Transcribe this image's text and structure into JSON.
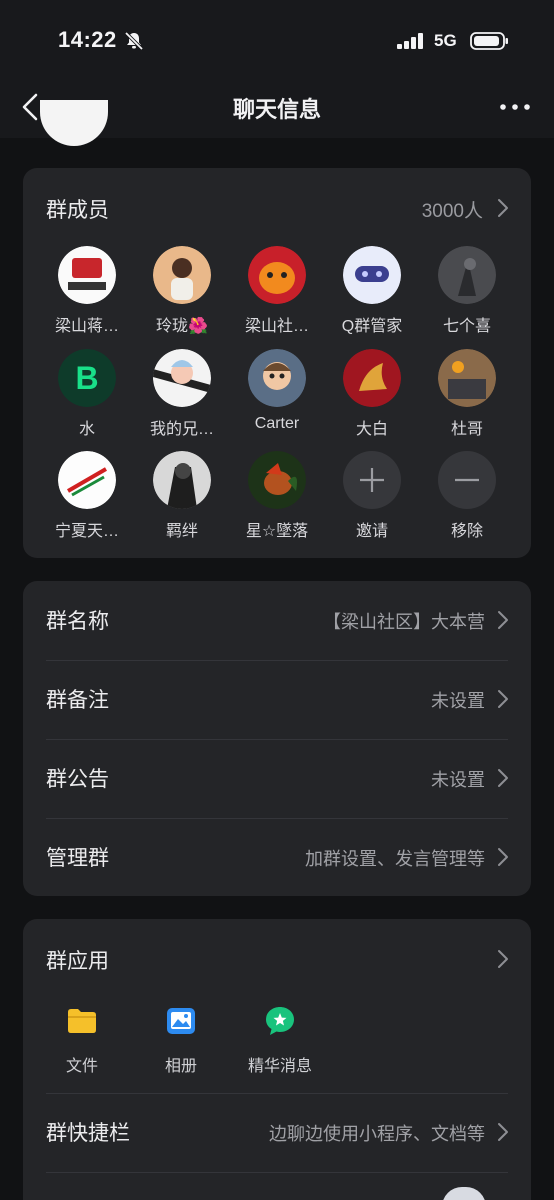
{
  "status": {
    "time": "14:22",
    "network": "5G"
  },
  "nav": {
    "title": "聊天信息"
  },
  "members": {
    "title": "群成员",
    "count": "3000人",
    "list": [
      {
        "name": "梁山蒋…"
      },
      {
        "name": "玲珑🌺"
      },
      {
        "name": "梁山社…"
      },
      {
        "name": "Q群管家"
      },
      {
        "name": "七个喜"
      },
      {
        "name": "水"
      },
      {
        "name": "我的兄…"
      },
      {
        "name": "Carter"
      },
      {
        "name": "大白"
      },
      {
        "name": "杜哥"
      },
      {
        "name": "宁夏天…"
      },
      {
        "name": "羁绊"
      },
      {
        "name": "星☆墜落"
      }
    ],
    "invite_label": "邀请",
    "remove_label": "移除"
  },
  "settings": [
    {
      "label": "群名称",
      "value": "【梁山社区】大本营"
    },
    {
      "label": "群备注",
      "value": "未设置"
    },
    {
      "label": "群公告",
      "value": "未设置"
    },
    {
      "label": "管理群",
      "value": "加群设置、发言管理等"
    }
  ],
  "apps": {
    "title": "群应用",
    "items": [
      {
        "label": "文件",
        "icon": "folder-icon",
        "color": "#f5c02a"
      },
      {
        "label": "相册",
        "icon": "photo-album-icon",
        "color": "#2d8bf0"
      },
      {
        "label": "精华消息",
        "icon": "essence-message-icon",
        "color": "#19c37d"
      }
    ],
    "shortcut_label": "群快捷栏",
    "shortcut_value": "边聊边使用小程序、文档等"
  },
  "colors": {
    "background": "#111214",
    "card": "#242528",
    "text_secondary": "#a0a1a6"
  }
}
